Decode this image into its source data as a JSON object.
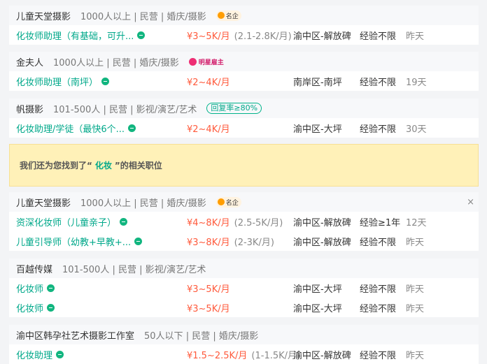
{
  "groups": [
    {
      "company": "儿童天堂摄影",
      "meta": "1000人以上 | 民营 | 婚庆/摄影",
      "badge": "名企",
      "jobs": [
        {
          "title": "化妆师助理（有基础，可升...",
          "salary": "¥3~5K/月",
          "salary_sub": "(2.1-2.8K/月)",
          "location": "渝中区-解放碑",
          "experience": "经验不限",
          "time": "昨天"
        }
      ]
    },
    {
      "company": "金夫人",
      "meta": "1000人以上 | 民营 | 婚庆/摄影",
      "badge": "明星雇主",
      "jobs": [
        {
          "title": "化妆师助理（南坪）",
          "salary": "¥2~4K/月",
          "salary_sub": "",
          "location": "南岸区-南坪",
          "experience": "经验不限",
          "time": "19天"
        }
      ]
    },
    {
      "company": "帆摄影",
      "meta": "101-500人 | 民营 | 影视/演艺/艺术",
      "badge": "回复率≥80%",
      "jobs": [
        {
          "title": "化妆助理/学徒（最快6个...",
          "salary": "¥2~4K/月",
          "salary_sub": "",
          "location": "渝中区-大坪",
          "experience": "经验不限",
          "time": "30天"
        }
      ]
    },
    {
      "company": "儿童天堂摄影",
      "meta": "1000人以上 | 民营 | 婚庆/摄影",
      "badge": "名企",
      "jobs": [
        {
          "title": "资深化妆师（儿童亲子）",
          "salary": "¥4~8K/月",
          "salary_sub": "(2.5-5K/月)",
          "location": "渝中区-解放碑",
          "experience": "经验≥1年",
          "time": "12天"
        },
        {
          "title": "儿童引导师（幼教+早教+...",
          "salary": "¥3~8K/月",
          "salary_sub": "(2-3K/月)",
          "location": "渝中区-解放碑",
          "experience": "经验不限",
          "time": "昨天"
        }
      ]
    },
    {
      "company": "百越传媒",
      "meta": "101-500人 | 民营 | 影视/演艺/艺术",
      "badge": "",
      "jobs": [
        {
          "title": "化妆师",
          "salary": "¥3~5K/月",
          "salary_sub": "",
          "location": "渝中区-大坪",
          "experience": "经验不限",
          "time": "昨天"
        },
        {
          "title": "化妆师",
          "salary": "¥3~5K/月",
          "salary_sub": "",
          "location": "渝中区-大坪",
          "experience": "经验不限",
          "time": "昨天"
        }
      ]
    },
    {
      "company": "渝中区韩孕社艺术摄影工作室",
      "meta": "50人以下 | 民营 | 婚庆/摄影",
      "badge": "",
      "jobs": [
        {
          "title": "化妆助理",
          "salary": "¥1.5~2.5K/月",
          "salary_sub": "(1-1.5K/月)",
          "location": "渝中区-解放碑",
          "experience": "经验不限",
          "time": "昨天"
        }
      ]
    }
  ],
  "notice": {
    "prefix": "我们还为您找到了“",
    "keyword": "化妆",
    "suffix": "”的相关职位"
  },
  "close_symbol": "×",
  "colors": {
    "accent": "#00a88a",
    "salary": "#ff5a3c",
    "notice_bg": "#fff1b8"
  }
}
